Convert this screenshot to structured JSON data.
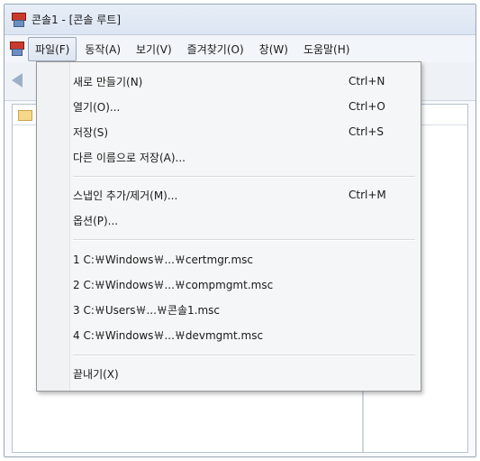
{
  "window": {
    "title": "콘솔1 - [콘솔 루트]"
  },
  "menubar": {
    "items": [
      {
        "label": "파일(F)"
      },
      {
        "label": "동작(A)"
      },
      {
        "label": "보기(V)"
      },
      {
        "label": "즐겨찾기(O)"
      },
      {
        "label": "창(W)"
      },
      {
        "label": "도움말(H)"
      }
    ]
  },
  "file_menu": {
    "items": [
      {
        "label": "새로 만들기(N)",
        "shortcut": "Ctrl+N"
      },
      {
        "label": "열기(O)...",
        "shortcut": "Ctrl+O"
      },
      {
        "label": "저장(S)",
        "shortcut": "Ctrl+S"
      },
      {
        "label": "다른 이름으로 저장(A)...",
        "shortcut": ""
      },
      {
        "label": "스냅인 추가/제거(M)...",
        "shortcut": "Ctrl+M"
      },
      {
        "label": "옵션(P)...",
        "shortcut": ""
      },
      {
        "label": "1 C:￦Windows￦...￦certmgr.msc",
        "shortcut": ""
      },
      {
        "label": "2 C:￦Windows￦...￦compmgmt.msc",
        "shortcut": ""
      },
      {
        "label": "3 C:￦Users￦...￦콘솔1.msc",
        "shortcut": ""
      },
      {
        "label": "4 C:￦Windows￦...￦devmgmt.msc",
        "shortcut": ""
      },
      {
        "label": "끝내기(X)",
        "shortcut": ""
      }
    ]
  },
  "icons": {
    "app": "mmc-console-icon",
    "back": "back-arrow-icon",
    "folder": "folder-icon"
  }
}
